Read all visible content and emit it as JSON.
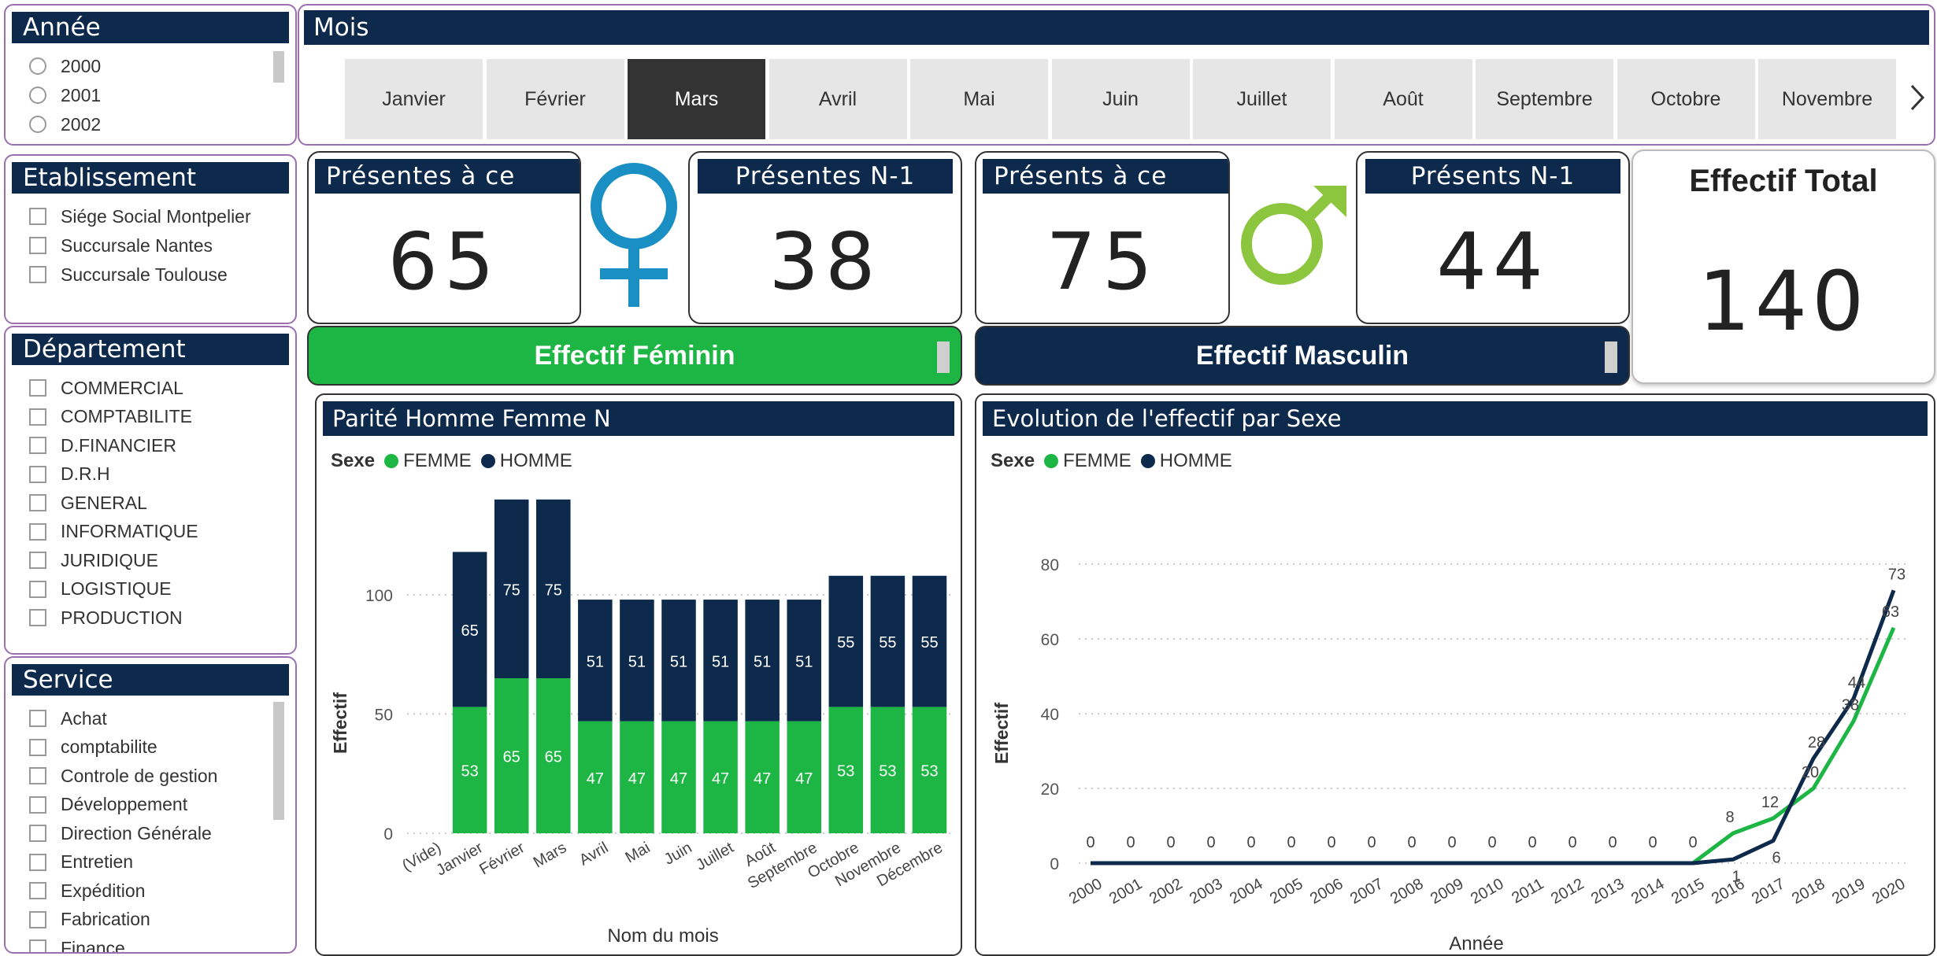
{
  "annee": {
    "title": "Année",
    "items": [
      "2000",
      "2001",
      "2002"
    ]
  },
  "etablissement": {
    "title": "Etablissement",
    "items": [
      "Siége Social Montpelier",
      "Succursale Nantes",
      "Succursale Toulouse"
    ]
  },
  "departement": {
    "title": "Département",
    "items": [
      "COMMERCIAL",
      "COMPTABILITE",
      "D.FINANCIER",
      "D.R.H",
      "GENERAL",
      "INFORMATIQUE",
      "JURIDIQUE",
      "LOGISTIQUE",
      "PRODUCTION"
    ]
  },
  "service": {
    "title": "Service",
    "items": [
      "Achat",
      "comptabilite",
      "Controle de gestion",
      "Développement",
      "Direction Générale",
      "Entretien",
      "Expédition",
      "Fabrication",
      "Finance"
    ]
  },
  "mois": {
    "title": "Mois",
    "items": [
      "Janvier",
      "Février",
      "Mars",
      "Avril",
      "Mai",
      "Juin",
      "Juillet",
      "Août",
      "Septembre",
      "Octobre",
      "Novembre"
    ],
    "selected": "Mars",
    "next_icon": "chevron-right-icon"
  },
  "cards": {
    "presentes_jour": {
      "title": "Présentes à ce jour",
      "value": "65"
    },
    "presentes_n1": {
      "title": "Présentes N-1",
      "value": "38"
    },
    "presents_jour": {
      "title": "Présents à ce jour",
      "value": "75"
    },
    "presents_n1": {
      "title": "Présents N-1",
      "value": "44"
    },
    "total": {
      "title": "Effectif Total",
      "value": "140"
    }
  },
  "icons": {
    "female": "female-symbol-icon",
    "male": "male-symbol-icon"
  },
  "buttons": {
    "feminin": "Effectif Féminin",
    "masculin": "Effectif Masculin"
  },
  "colors": {
    "navy": "#0d2a4d",
    "femme": "#1db644",
    "homme": "#0d2a4d",
    "female_icon": "#1a8fc4",
    "male_icon": "#8cc63f",
    "selected_month": "#333333"
  },
  "chart_data": [
    {
      "type": "bar",
      "stacked": true,
      "title": "Parité Homme Femme N",
      "legend_title": "Sexe",
      "xlabel": "Nom du mois",
      "ylabel": "Effectif",
      "categories": [
        "(Vide)",
        "Janvier",
        "Février",
        "Mars",
        "Avril",
        "Mai",
        "Juin",
        "Juillet",
        "Août",
        "Septembre",
        "Octobre",
        "Novembre",
        "Décembre"
      ],
      "series": [
        {
          "name": "FEMME",
          "values": [
            null,
            53,
            65,
            65,
            47,
            47,
            47,
            47,
            47,
            47,
            53,
            53,
            53
          ]
        },
        {
          "name": "HOMME",
          "values": [
            null,
            65,
            75,
            75,
            51,
            51,
            51,
            51,
            51,
            51,
            55,
            55,
            55
          ]
        }
      ],
      "yticks": [
        0,
        50,
        100
      ],
      "ylim": [
        0,
        140
      ],
      "grid": true,
      "legend_position": "top-left"
    },
    {
      "type": "line",
      "title": "Evolution de l'effectif par Sexe",
      "legend_title": "Sexe",
      "xlabel": "Année",
      "ylabel": "Effectif",
      "x": [
        "2000",
        "2001",
        "2002",
        "2003",
        "2004",
        "2005",
        "2006",
        "2007",
        "2008",
        "2009",
        "2010",
        "2011",
        "2012",
        "2013",
        "2014",
        "2015",
        "2016",
        "2017",
        "2018",
        "2019",
        "2020"
      ],
      "series": [
        {
          "name": "FEMME",
          "values": [
            0,
            0,
            0,
            0,
            0,
            0,
            0,
            0,
            0,
            0,
            0,
            0,
            0,
            0,
            0,
            0,
            8,
            12,
            20,
            38,
            63
          ]
        },
        {
          "name": "HOMME",
          "values": [
            0,
            0,
            0,
            0,
            0,
            0,
            0,
            0,
            0,
            0,
            0,
            0,
            0,
            0,
            0,
            0,
            1,
            6,
            28,
            44,
            73
          ]
        }
      ],
      "yticks": [
        0,
        20,
        40,
        60,
        80
      ],
      "ylim": [
        0,
        80
      ],
      "grid": true,
      "legend_position": "top-left"
    }
  ]
}
